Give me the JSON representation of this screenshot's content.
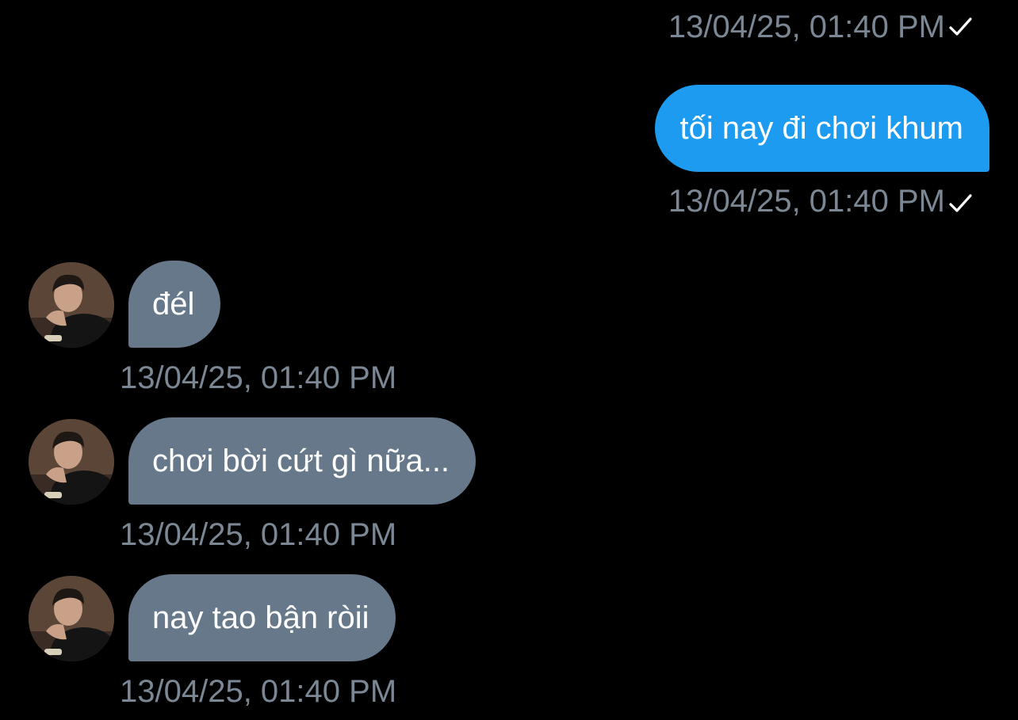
{
  "messages": [
    {
      "direction": "outgoing",
      "timestamp": "13/04/25, 01:40 PM",
      "status_icon": "check-icon",
      "partial": true
    },
    {
      "direction": "outgoing",
      "text": "tối nay đi chơi khum",
      "timestamp": "13/04/25, 01:40 PM",
      "status_icon": "check-icon"
    },
    {
      "direction": "incoming",
      "text": "đél",
      "timestamp": "13/04/25, 01:40 PM"
    },
    {
      "direction": "incoming",
      "text": "chơi bời cứt gì nữa...",
      "timestamp": "13/04/25, 01:40 PM"
    },
    {
      "direction": "incoming",
      "text": "nay tao bận ròii",
      "timestamp": "13/04/25, 01:40 PM"
    }
  ],
  "colors": {
    "background": "#000000",
    "outgoing_bubble": "#1d9bf0",
    "incoming_bubble": "#66788a",
    "timestamp_text": "#7b8794",
    "message_text": "#ffffff"
  }
}
